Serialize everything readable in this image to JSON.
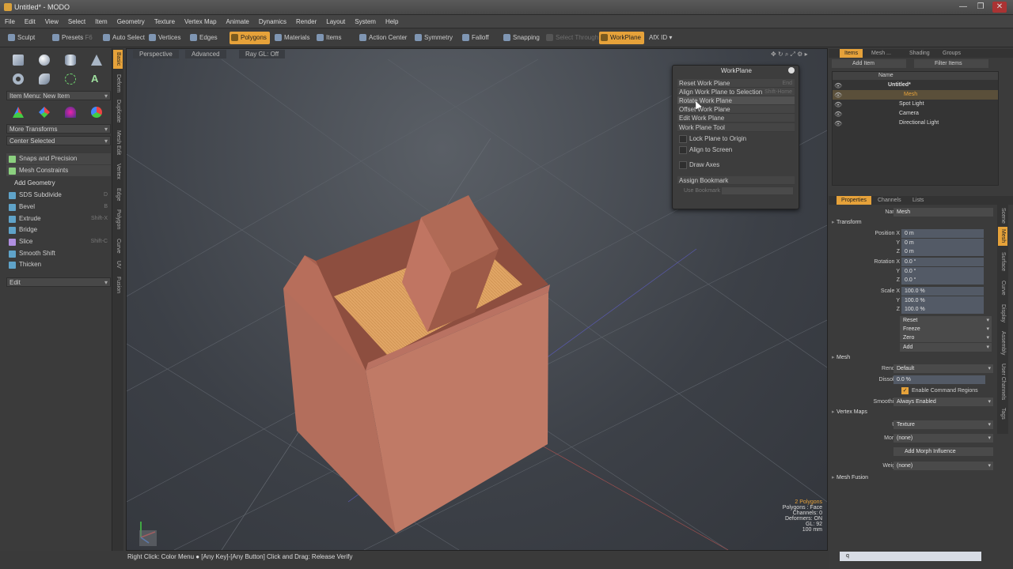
{
  "window": {
    "title": "Untitled* - MODO",
    "controls": [
      "—",
      "❐",
      "✕"
    ]
  },
  "menu": [
    "File",
    "Edit",
    "View",
    "Select",
    "Item",
    "Geometry",
    "Texture",
    "Vertex Map",
    "Animate",
    "Dynamics",
    "Render",
    "Layout",
    "System",
    "Help"
  ],
  "toolbar": {
    "sculpt": "Sculpt",
    "presets": "Presets",
    "presets_key": "F6",
    "auto_select": "Auto Select",
    "vertices": "Vertices",
    "edges": "Edges",
    "polygons": "Polygons",
    "materials": "Materials",
    "items": "Items",
    "action_center": "Action Center",
    "symmetry": "Symmetry",
    "falloff": "Falloff",
    "snapping": "Snapping",
    "select_through": "Select Through",
    "workplane": "WorkPlane",
    "afx": "AfX ID"
  },
  "left": {
    "item_menu": "Item Menu: New Item",
    "more_transforms": "More Transforms",
    "center_selected": "Center Selected",
    "snaps": "Snaps and Precision",
    "constraints": "Mesh Constraints",
    "add_geometry": "Add Geometry",
    "tools": [
      {
        "label": "SDS Subdivide",
        "key": "D"
      },
      {
        "label": "Bevel",
        "key": "B"
      },
      {
        "label": "Extrude",
        "key": "Shift-X"
      },
      {
        "label": "Bridge",
        "key": ""
      },
      {
        "label": "Slice",
        "key": "Shift-C"
      },
      {
        "label": "Smooth Shift",
        "key": ""
      },
      {
        "label": "Thicken",
        "key": ""
      }
    ],
    "edit": "Edit",
    "vtabs": [
      "Basic",
      "Deform",
      "Duplicate",
      "Mesh Edit",
      "Vertex",
      "Edge",
      "Polygon",
      "Curve",
      "UV",
      "Fusion"
    ]
  },
  "viewport": {
    "perspective": "Perspective",
    "advanced": "Advanced",
    "raygl": "Ray GL: Off",
    "stats": [
      "2 Polygons",
      "Polygons : Face",
      "Channels: 0",
      "Deformers: ON",
      "GL: 92",
      "100 mm"
    ]
  },
  "workplane": {
    "title": "WorkPlane",
    "items": [
      {
        "label": "Reset Work Plane",
        "key": "End"
      },
      {
        "label": "Align Work Plane to Selection",
        "key": "Shift-Home"
      },
      {
        "label": "Rotate Work Plane",
        "key": ""
      },
      {
        "label": "Offset Work Plane",
        "key": ""
      },
      {
        "label": "Edit Work Plane",
        "key": ""
      },
      {
        "label": "Work Plane Tool",
        "key": ""
      }
    ],
    "lock": "Lock Plane to Origin",
    "align": "Align to Screen",
    "draw_axes": "Draw Axes",
    "assign": "Assign Bookmark",
    "use": "Use Bookmark"
  },
  "status": "Right Click: Color Menu ● [Any Key]-[Any Button] Click and Drag: Release Verify",
  "right": {
    "tabs": [
      "Items",
      "Mesh ...",
      "Shading",
      "Groups"
    ],
    "add_item": "Add Item",
    "filter": "Filter Items",
    "name_col": "Name",
    "tree": [
      "Untitled*",
      "Mesh",
      "Spot Light",
      "Camera",
      "Directional Light"
    ],
    "ptabs": [
      "Properties",
      "Channels",
      "Lists"
    ],
    "name_label": "Name",
    "name_value": "Mesh",
    "transform": "Transform",
    "pos": [
      "Position X",
      "Y",
      "Z"
    ],
    "pos_vals": [
      "0 m",
      "0 m",
      "0 m"
    ],
    "rot": [
      "Rotation X",
      "Y",
      "Z"
    ],
    "rot_vals": [
      "0.0 °",
      "0.0 °",
      "0.0 °"
    ],
    "scl": [
      "Scale X",
      "Y",
      "Z"
    ],
    "scl_vals": [
      "100.0 %",
      "100.0 %",
      "100.0 %"
    ],
    "actions": [
      "Reset",
      "Freeze",
      "Zero",
      "Add"
    ],
    "mesh": "Mesh",
    "render": "Render",
    "render_val": "Default",
    "dissolve": "Dissolve",
    "dissolve_val": "0.0 %",
    "enable_cmd": "Enable Command Regions",
    "smoothing": "Smoothing",
    "smoothing_val": "Always Enabled",
    "vmaps": "Vertex Maps",
    "uv": "UV",
    "uv_val": "Texture",
    "morph": "Morph",
    "morph_val": "(none)",
    "add_morph": "Add Morph Influence",
    "weight": "Weight",
    "weight_val": "(none)",
    "fusion": "Mesh Fusion",
    "side_tabs": [
      "Scene",
      "Mesh",
      "Surface",
      "Curve",
      "Display",
      "Assembly",
      "User Channels",
      "Tags"
    ],
    "cmd": "q"
  }
}
